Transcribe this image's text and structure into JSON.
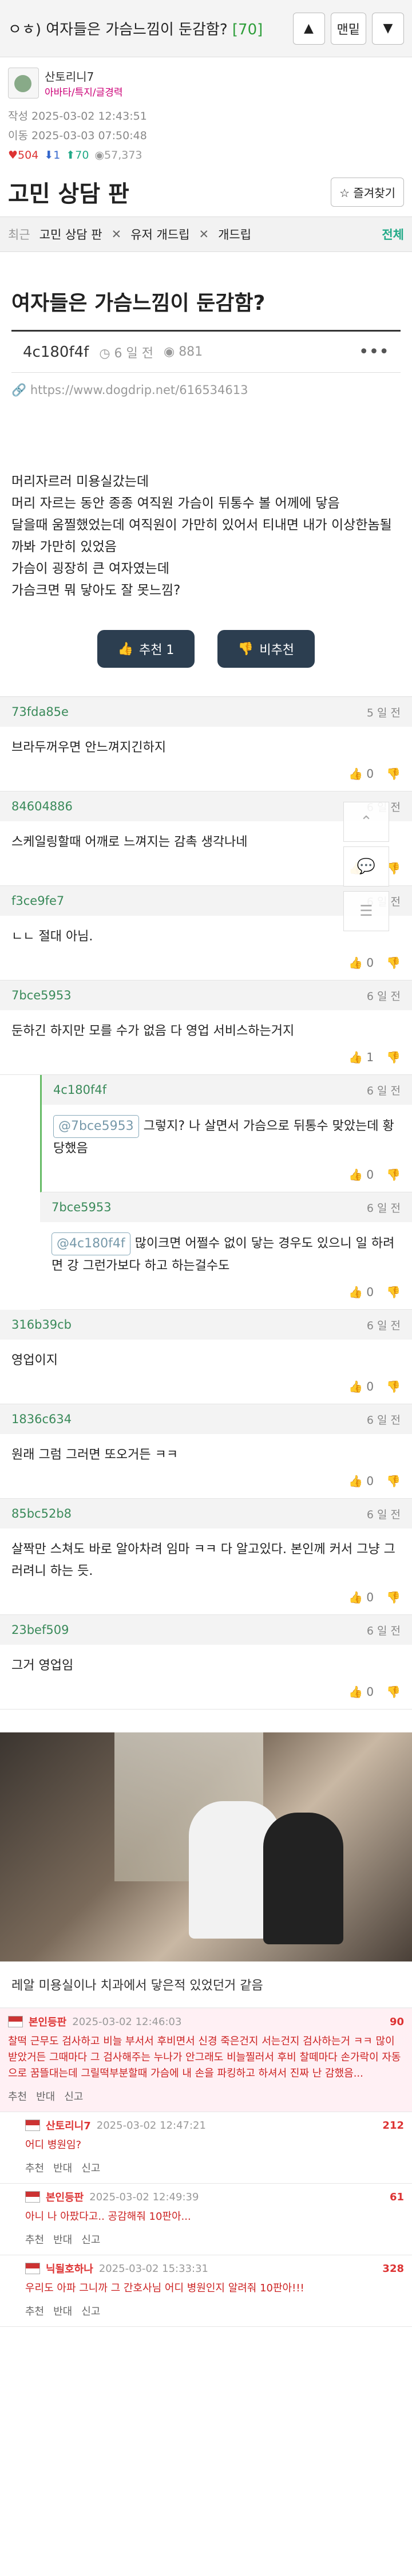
{
  "topbar": {
    "title_prefix": "ㅇㅎ) 여자들은 가슴느낌이 둔감함?",
    "count": "[70]",
    "up_icon": "▲",
    "sort_label": "맨밑",
    "down_icon": "▼"
  },
  "author": {
    "name": "산토리니7",
    "group": "아바타/특지/글경력"
  },
  "meta": {
    "written": "작성 2025-03-02 12:43:51",
    "moved": "이동 2025-03-03 07:50:48"
  },
  "stats": {
    "comments": "504",
    "downs": "1",
    "ups": "70",
    "views": "57,373"
  },
  "board": {
    "title": "고민 상담 판",
    "fav_label": "즐겨찾기"
  },
  "crumbs": {
    "label": "최근",
    "items": [
      "고민 상담 판",
      "유저 개드립",
      "개드립"
    ],
    "all": "전체"
  },
  "post": {
    "title": "여자들은 가슴느낌이 둔감함?",
    "id": "4c180f4f",
    "time": "6 일 전",
    "views": "881",
    "url": "https://www.dogdrip.net/616534613",
    "body": [
      "머리자르러 미용실갔는데",
      "머리 자르는 동안 종종 여직원 가슴이 뒤통수 볼 어께에 닿음",
      "달을때 움찔했었는데 여직원이 가만히 있어서 티내면 내가 이상한놈될까봐 가만히 있었음",
      "가슴이 굉장히 큰 여자였는데",
      "가슴크면 뭐 닿아도 잘 못느낌?"
    ],
    "up_label": "추천 1",
    "down_label": "비추천"
  },
  "comments": [
    {
      "user": "73fda85e",
      "date": "5 일 전",
      "text": "브라두꺼우면 안느껴지긴하지",
      "up": "0"
    },
    {
      "user": "84604886",
      "date": "6 일 전",
      "text": "스케일링할때 어깨로 느껴지는 감촉 생각나네",
      "up": "0"
    },
    {
      "user": "f3ce9fe7",
      "date": "6 일 전",
      "text": "ㄴㄴ 절대 아님.",
      "up": "0"
    },
    {
      "user": "7bce5953",
      "date": "6 일 전",
      "text": "둔하긴 하지만 모를 수가 없음 다 영업 서비스하는거지",
      "up": "1"
    },
    {
      "user": "4c180f4f",
      "date": "6 일 전",
      "mention": "@7bce5953",
      "text": "그렇지? 나 살면서 가슴으로 뒤통수 맞았는데 황당했음",
      "up": "0",
      "reply": true
    },
    {
      "user": "7bce5953",
      "date": "6 일 전",
      "mention": "@4c180f4f",
      "text": "많이크면 어쩔수 없이 닿는 경우도 있으니 일 하려면 강 그런가보다 하고 하는걸수도",
      "up": "0",
      "reply2": true
    },
    {
      "user": "316b39cb",
      "date": "6 일 전",
      "text": "영업이지",
      "up": "0"
    },
    {
      "user": "1836c634",
      "date": "6 일 전",
      "text": "원래 그럼 그러면 또오거든 ㅋㅋ",
      "up": "0"
    },
    {
      "user": "85bc52b8",
      "date": "6 일 전",
      "text": "살짝만 스쳐도 바로 알아차려 임마 ㅋㅋ 다 알고있다. 본인께 커서 그냥 그러려니 하는 듯.",
      "up": "0"
    },
    {
      "user": "23bef509",
      "date": "6 일 전",
      "text": "그거 영업임",
      "up": "0"
    }
  ],
  "image_caption": "레알 미용실이나 치과에서 닿은적 있었던거 같음",
  "ext": {
    "rows": [
      {
        "name": "본인등판",
        "time": "2025-03-02 12:46:03",
        "num": "90",
        "text": "찰떡 근무도 검사하고 비늘 부서서 후비면서 신경 죽은건지 서는건지 검사하는거 ㅋㅋ 많이 받았거든 그때마다 그 검사해주는 누나가 안그래도 비늘찔러서 후비 찰떼마다 손가락이 자동으로 꿈뜰대는데 그릴떡부분할때 가슴에 내 손을 파킹하고 하셔서 진짜 난 감했음...",
        "pink": true
      },
      {
        "name": "산토리니7",
        "time": "2025-03-02 12:47:21",
        "num": "212",
        "text": "어디 병원임?"
      },
      {
        "name": "본인등판",
        "time": "2025-03-02 12:49:39",
        "num": "61",
        "text": "아니 나 아팠다고.. 공감해줘 10판아..."
      },
      {
        "name": "닉될호하나",
        "time": "2025-03-02 15:33:31",
        "num": "328",
        "text": "우리도 아파 그니까 그 간호사님 어디 병원인지 알려줘 10판아!!!"
      }
    ],
    "up": "추천",
    "down": "반대",
    "report": "신고"
  },
  "colors": {
    "accent": "#2c3e50",
    "green": "#2e9e3a",
    "red": "#d33333"
  }
}
